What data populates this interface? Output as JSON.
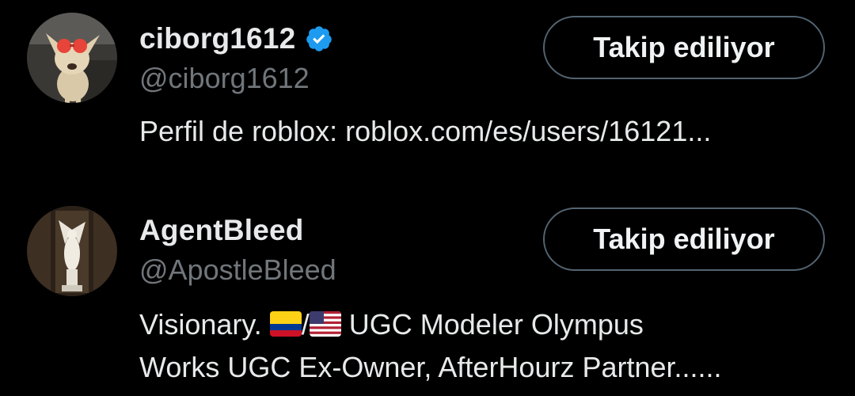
{
  "users": [
    {
      "display_name": "ciborg1612",
      "verified": true,
      "handle": "@ciborg1612",
      "follow_label": "Takip ediliyor",
      "bio_line1": "Perfil de roblox: roblox.com/es/users/16121...",
      "avatar": "chihuahua-with-heart-glasses-avatar"
    },
    {
      "display_name": "AgentBleed",
      "verified": false,
      "handle": "@ApostleBleed",
      "follow_label": "Takip ediliyor",
      "bio_line1_prefix": "Visionary. ",
      "bio_line1_sep": "/",
      "bio_line1_suffix": " UGC Modeler Olympus",
      "bio_line2": "Works UGC Ex-Owner, AfterHourz Partner......",
      "bio_flags": [
        "colombia-flag-icon",
        "usa-flag-icon"
      ],
      "avatar": "angel-statue-avatar"
    }
  ],
  "colors": {
    "background": "#000000",
    "primary_text": "#e7e9ea",
    "secondary_text": "#71767b",
    "button_border": "#536471",
    "verified_badge": "#1d9bf0"
  }
}
